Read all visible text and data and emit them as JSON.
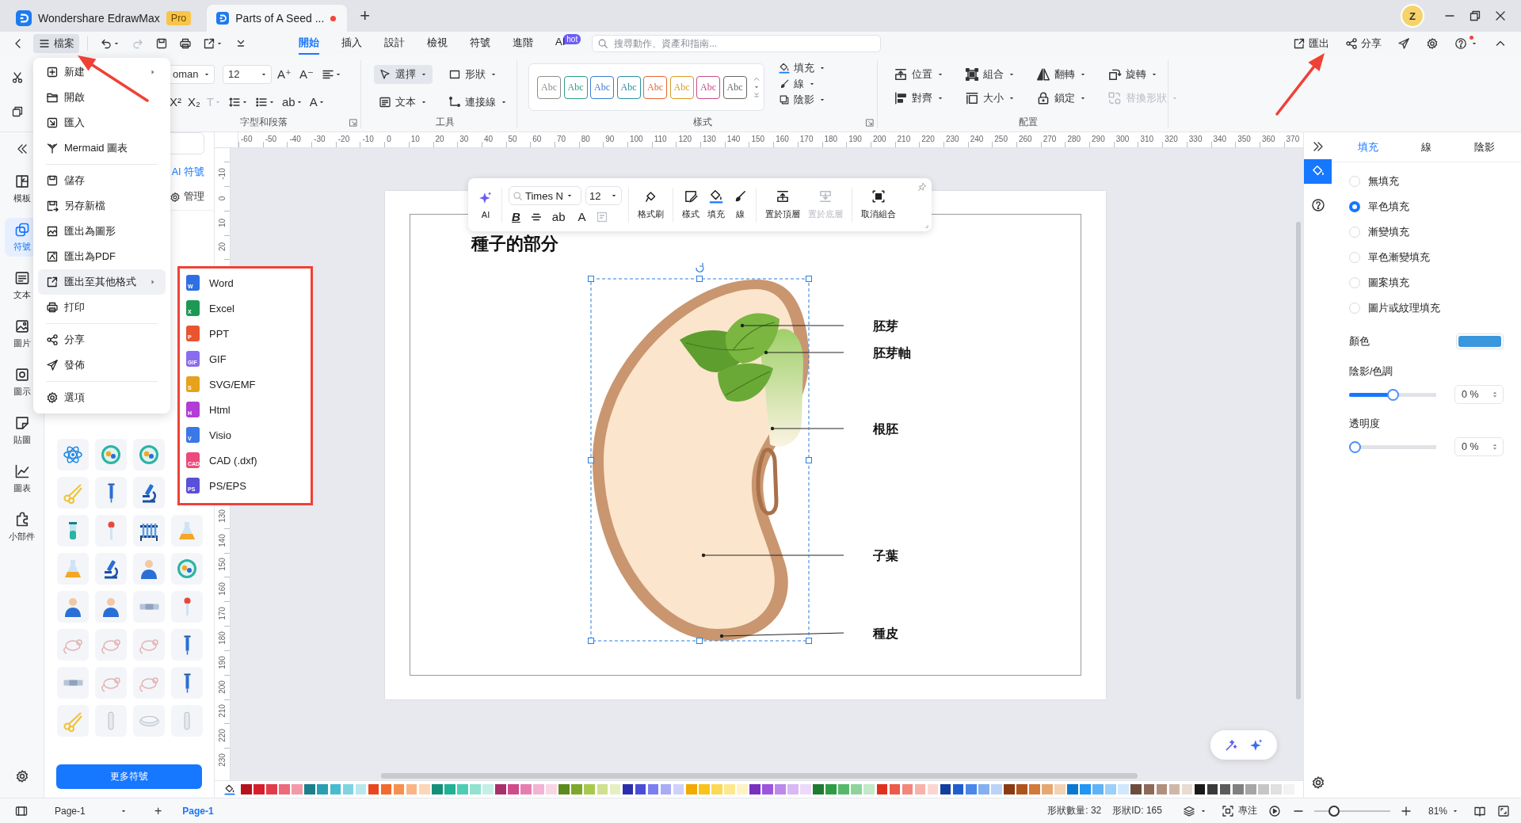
{
  "title_bar": {
    "tabs": [
      {
        "kind": "home",
        "title": "Wondershare EdrawMax",
        "badge": "Pro",
        "selected": false
      },
      {
        "kind": "document",
        "title": "Parts of A Seed ...",
        "unsaved": true,
        "selected": true
      }
    ],
    "new_tab": "+",
    "avatar": "Z"
  },
  "toolbar": {
    "file_button": {
      "label": "檔案",
      "selected": true
    },
    "redo_disabled": true,
    "tabs": [
      {
        "label": "開始",
        "selected": true
      },
      {
        "label": "插入",
        "selected": false
      },
      {
        "label": "設計",
        "selected": false
      },
      {
        "label": "檢視",
        "selected": false
      },
      {
        "label": "符號",
        "selected": false
      },
      {
        "label": "進階",
        "selected": false
      },
      {
        "label": "AI",
        "badge": "hot",
        "selected": false
      }
    ],
    "search": {
      "placeholder": "搜尋動作、資產和指南..."
    },
    "export": "匯出",
    "share": "分享",
    "help_notification": true
  },
  "ribbon": {
    "font": {
      "font_name": "oman",
      "font_size": "12",
      "grow": "A⁺",
      "shrink": "A⁻",
      "superscript": "X²",
      "subscript": "X₂",
      "text_effect": {
        "glyph": "T",
        "disabled": true
      },
      "case": "ab",
      "font_color": "A",
      "group_label": "字型和段落"
    },
    "tools": {
      "items": [
        {
          "label": "選擇",
          "selected": true
        },
        {
          "label": "形狀",
          "selected": false
        },
        {
          "label": "文本",
          "selected": false
        },
        {
          "label": "連接線",
          "selected": false
        }
      ],
      "group_label": "工具"
    },
    "styles": {
      "swatches": [
        {
          "label": "Abc",
          "color": "#8c8c8c"
        },
        {
          "label": "Abc",
          "color": "#2e9e84"
        },
        {
          "label": "Abc",
          "color": "#3a7bd5"
        },
        {
          "label": "Abc",
          "color": "#2a8fa0"
        },
        {
          "label": "Abc",
          "color": "#e0663a"
        },
        {
          "label": "Abc",
          "color": "#d99a22"
        },
        {
          "label": "Abc",
          "color": "#c84a86"
        },
        {
          "label": "Abc",
          "color": "#666666"
        }
      ],
      "group_label": "樣式"
    },
    "format": [
      "填充",
      "線",
      "陰影"
    ],
    "arrange": {
      "items": [
        {
          "label": "位置",
          "disabled": false
        },
        {
          "label": "組合",
          "disabled": false
        },
        {
          "label": "翻轉",
          "disabled": false
        },
        {
          "label": "旋轉",
          "disabled": false
        },
        {
          "label": "對齊",
          "disabled": false
        },
        {
          "label": "大小",
          "disabled": false
        },
        {
          "label": "鎖定",
          "disabled": false
        },
        {
          "label": "替換形狀",
          "disabled": true
        }
      ],
      "group_label": "配置"
    }
  },
  "left_rail": {
    "items": [
      {
        "label": "模板",
        "selected": false
      },
      {
        "label": "符號",
        "selected": true
      },
      {
        "label": "文本",
        "selected": false
      },
      {
        "label": "圖片",
        "selected": false
      },
      {
        "label": "圖示",
        "selected": false
      },
      {
        "label": "貼圖",
        "selected": false
      },
      {
        "label": "圖表",
        "selected": false
      },
      {
        "label": "小部件",
        "selected": false
      }
    ]
  },
  "symbol_panel": {
    "ai_link": "AI 符號",
    "manage": "管理",
    "more_button": "更多符號"
  },
  "file_menu": {
    "groups": [
      [
        {
          "label": "新建",
          "has_submenu": true,
          "selected": false
        },
        {
          "label": "開啟",
          "has_submenu": false,
          "selected": false
        },
        {
          "label": "匯入",
          "has_submenu": false,
          "selected": false
        },
        {
          "label": "Mermaid 圖表",
          "has_submenu": false,
          "selected": false
        }
      ],
      [
        {
          "label": "儲存",
          "has_submenu": false,
          "selected": false
        },
        {
          "label": "另存新檔",
          "has_submenu": false,
          "selected": false
        },
        {
          "label": "匯出為圖形",
          "has_submenu": false,
          "selected": false
        },
        {
          "label": "匯出為PDF",
          "has_submenu": false,
          "selected": false
        },
        {
          "label": "匯出至其他格式",
          "has_submenu": true,
          "selected": true
        },
        {
          "label": "打印",
          "has_submenu": false,
          "selected": false
        }
      ],
      [
        {
          "label": "分享",
          "has_submenu": false,
          "selected": false
        },
        {
          "label": "發佈",
          "has_submenu": false,
          "selected": false
        }
      ],
      [
        {
          "label": "選項",
          "has_submenu": false,
          "selected": false
        }
      ]
    ]
  },
  "export_submenu": {
    "items": [
      {
        "label": "Word",
        "icon_text": "W",
        "color": "#2f6fe4"
      },
      {
        "label": "Excel",
        "icon_text": "X",
        "color": "#1c9a55"
      },
      {
        "label": "PPT",
        "icon_text": "P",
        "color": "#e8552e"
      },
      {
        "label": "GIF",
        "icon_text": "GIF",
        "color": "#8a6cf0"
      },
      {
        "label": "SVG/EMF",
        "icon_text": "S",
        "color": "#e6a21c"
      },
      {
        "label": "Html",
        "icon_text": "H",
        "color": "#b23cd6"
      },
      {
        "label": "Visio",
        "icon_text": "V",
        "color": "#3a78e8"
      },
      {
        "label": "CAD (.dxf)",
        "icon_text": "CAD",
        "color": "#ec4a7a"
      },
      {
        "label": "PS/EPS",
        "icon_text": "PS",
        "color": "#5a4fd8"
      }
    ]
  },
  "horizontal_ruler": [
    "-60",
    "-50",
    "-40",
    "-30",
    "-20",
    "-10",
    "0",
    "10",
    "20",
    "30",
    "40",
    "50",
    "60",
    "70",
    "80",
    "90",
    "100",
    "110",
    "120",
    "130",
    "140",
    "150",
    "160",
    "170",
    "180",
    "190",
    "200",
    "210",
    "220",
    "230",
    "240",
    "250",
    "260",
    "270",
    "280",
    "290",
    "300",
    "310",
    "320",
    "330",
    "340",
    "350",
    "360",
    "370"
  ],
  "vertical_ruler": {
    "upper": [
      "-10",
      "0",
      "10",
      "20"
    ],
    "lower": [
      "130",
      "140",
      "150",
      "160",
      "170",
      "180",
      "190",
      "200",
      "210",
      "220",
      "230"
    ]
  },
  "floating_toolbar": {
    "ai": "AI",
    "font": "Times N",
    "size": "12",
    "bold": "B",
    "case": "ab",
    "font_color": "A",
    "actions": [
      {
        "label": "格式刷",
        "disabled": false
      },
      {
        "label": "樣式",
        "disabled": false
      },
      {
        "label": "填充",
        "disabled": false
      },
      {
        "label": "線",
        "disabled": false
      },
      {
        "label": "置於頂層",
        "disabled": false
      },
      {
        "label": "置於底層",
        "disabled": true
      },
      {
        "label": "取消組合",
        "disabled": false
      }
    ]
  },
  "diagram": {
    "title": "種子的部分",
    "selected": true,
    "labels": [
      "胚芽",
      "胚芽軸",
      "根胚",
      "子葉",
      "種皮"
    ]
  },
  "right_panel": {
    "tabs": [
      {
        "label": "填充",
        "selected": true
      },
      {
        "label": "線",
        "selected": false
      },
      {
        "label": "陰影",
        "selected": false
      }
    ],
    "fill_options": [
      {
        "label": "無填充",
        "selected": false
      },
      {
        "label": "單色填充",
        "selected": true
      },
      {
        "label": "漸變填充",
        "selected": false
      },
      {
        "label": "單色漸變填充",
        "selected": false
      },
      {
        "label": "圖案填充",
        "selected": false
      },
      {
        "label": "圖片或紋理填充",
        "selected": false
      }
    ],
    "color": {
      "label": "顏色",
      "color": "#3b97dc"
    },
    "shade": {
      "label": "陰影/色調",
      "level": 0.5,
      "reading": "0 %"
    },
    "transparency": {
      "label": "透明度",
      "level": 0,
      "reading": "0 %"
    }
  },
  "palette": [
    {
      "color": "#b5121b"
    },
    {
      "color": "#d81e2c"
    },
    {
      "color": "#e03c4b"
    },
    {
      "color": "#ec6a7a"
    },
    {
      "color": "#f29aa8"
    },
    {
      "color": "#1b7f8c"
    },
    {
      "color": "#2a9fb3"
    },
    {
      "color": "#45bcd0"
    },
    {
      "color": "#7fd3e0"
    },
    {
      "color": "#b8e8ee"
    },
    {
      "color": "#e8471f"
    },
    {
      "color": "#f26a2e"
    },
    {
      "color": "#f7904f"
    },
    {
      "color": "#fbb584"
    },
    {
      "color": "#fdd6b8"
    },
    {
      "color": "#14907a"
    },
    {
      "color": "#1fb295"
    },
    {
      "color": "#4fcdb3"
    },
    {
      "color": "#92e2d0"
    },
    {
      "color": "#c4efe6"
    },
    {
      "color": "#a8306b"
    },
    {
      "color": "#cf4b8b"
    },
    {
      "color": "#e67fb0"
    },
    {
      "color": "#f2b4d2"
    },
    {
      "color": "#f8d6e6"
    },
    {
      "color": "#5b8a1d"
    },
    {
      "color": "#7ea82c"
    },
    {
      "color": "#a9c94e"
    },
    {
      "color": "#cfe08f"
    },
    {
      "color": "#e6efc1"
    },
    {
      "color": "#2b2fae"
    },
    {
      "color": "#4a4ed6"
    },
    {
      "color": "#7b7ef0"
    },
    {
      "color": "#a9acf6"
    },
    {
      "color": "#d0d1fb"
    },
    {
      "color": "#f2a900"
    },
    {
      "color": "#f8c41c"
    },
    {
      "color": "#fbd956"
    },
    {
      "color": "#fde88f"
    },
    {
      "color": "#fef3c5"
    },
    {
      "color": "#7b2fbf"
    },
    {
      "color": "#9c55dc"
    },
    {
      "color": "#bd88ec"
    },
    {
      "color": "#d9b8f5"
    },
    {
      "color": "#ecdafb"
    },
    {
      "color": "#1f7a32"
    },
    {
      "color": "#2f9c45"
    },
    {
      "color": "#56b96a"
    },
    {
      "color": "#8fd39c"
    },
    {
      "color": "#c3e9c9"
    },
    {
      "color": "#e0301e"
    },
    {
      "color": "#ec5a4a"
    },
    {
      "color": "#f3877b"
    },
    {
      "color": "#f8b2a9"
    },
    {
      "color": "#fbd6d1"
    },
    {
      "color": "#123f9e"
    },
    {
      "color": "#1e5fcf"
    },
    {
      "color": "#4a87e8"
    },
    {
      "color": "#84aff1"
    },
    {
      "color": "#bcd3f7"
    },
    {
      "color": "#8a3b12"
    },
    {
      "color": "#b0541d"
    },
    {
      "color": "#d27a3a"
    },
    {
      "color": "#e6a774"
    },
    {
      "color": "#f3d2b3"
    },
    {
      "color": "#0a78d1"
    },
    {
      "color": "#2196f3"
    },
    {
      "color": "#5db3f6"
    },
    {
      "color": "#9ccff9"
    },
    {
      "color": "#d1e8fc"
    },
    {
      "color": "#6d4c3d"
    },
    {
      "color": "#8d6a58"
    },
    {
      "color": "#b08f7d"
    },
    {
      "color": "#cfb7a8"
    },
    {
      "color": "#e8dbd2"
    },
    {
      "color": "#1a1a1a"
    },
    {
      "color": "#3a3a3a"
    },
    {
      "color": "#5c5c5c"
    },
    {
      "color": "#808080"
    },
    {
      "color": "#a6a6a6"
    },
    {
      "color": "#c6c6c6"
    },
    {
      "color": "#e0e0e0"
    },
    {
      "color": "#f2f2f2"
    }
  ],
  "status_bar": {
    "page_selector": "Page-1",
    "add_page": "+",
    "pages": [
      {
        "label": "Page-1",
        "selected": true
      }
    ],
    "shape_count": "形狀數量: 32",
    "shape_id": "形狀ID: 165",
    "focus": "專注",
    "zoom": {
      "level": 0.22,
      "reading": "81%"
    }
  }
}
